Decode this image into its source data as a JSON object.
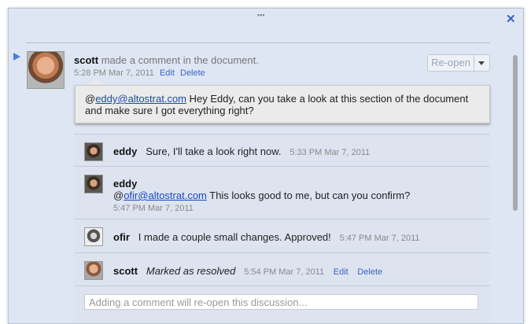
{
  "window": {
    "grip_glyph": "▪▪▪",
    "close_glyph": "✕"
  },
  "thread": {
    "author": "scott",
    "action": "made a comment in the document.",
    "timestamp": "5:28 PM Mar 7, 2011",
    "edit_label": "Edit",
    "delete_label": "Delete",
    "reopen_label": "Re-open",
    "comment": {
      "mention": "eddy@altostrat.com",
      "prefix": "@",
      "text": " Hey Eddy, can you take a look at this section of the document and make sure I got everything right?"
    }
  },
  "replies": [
    {
      "author": "eddy",
      "text": "Sure, I'll take a look right now.",
      "timestamp": "5:33 PM Mar 7, 2011"
    },
    {
      "author": "eddy",
      "prefix": "@",
      "mention": "ofir@altostrat.com",
      "text": " This looks good to me, but can you confirm?",
      "timestamp": "5:47 PM Mar 7, 2011"
    },
    {
      "author": "ofir",
      "text": "I made a couple small changes. Approved!",
      "timestamp": "5:47 PM Mar 7, 2011"
    },
    {
      "author": "scott",
      "text": "Marked as resolved",
      "timestamp": "5:54 PM Mar 7, 2011",
      "edit_label": "Edit",
      "delete_label": "Delete"
    }
  ],
  "input": {
    "placeholder": "Adding a comment will re-open this discussion..."
  },
  "colors": {
    "panel_bg": "#dfe6f3",
    "link": "#3a63c6",
    "accent": "#4d7be0"
  }
}
